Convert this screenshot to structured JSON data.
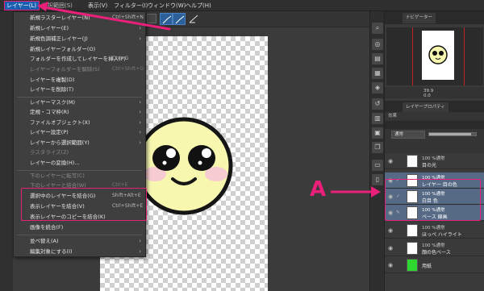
{
  "menubar": {
    "items": [
      "レイヤー(L)",
      "選択範囲(S)",
      "表示(V)",
      "フィルター(I)",
      "ウィンドウ(W)",
      "ヘルプ(H)"
    ]
  },
  "layer_menu": {
    "items": [
      {
        "label": "新規ラスターレイヤー(N)",
        "shortcut": "Ctrl+Shift+N",
        "disabled": false,
        "submenu": false
      },
      {
        "label": "新規レイヤー(E)",
        "shortcut": "",
        "disabled": false,
        "submenu": true
      },
      {
        "label": "新規色調補正レイヤー(J)",
        "shortcut": "",
        "disabled": false,
        "submenu": true
      },
      {
        "label": "新規レイヤーフォルダー(O)",
        "shortcut": "",
        "disabled": false,
        "submenu": false
      },
      {
        "label": "フォルダーを作成してレイヤーを挿入(F)",
        "shortcut": "Ctrl+G",
        "disabled": false,
        "submenu": false
      },
      {
        "label": "レイヤーフォルダーを解除(S)",
        "shortcut": "Ctrl+Shift+G",
        "disabled": true,
        "submenu": false
      },
      {
        "label": "レイヤーを複製(D)",
        "shortcut": "",
        "disabled": false,
        "submenu": false
      },
      {
        "label": "レイヤーを削除(T)",
        "shortcut": "",
        "disabled": false,
        "submenu": false
      },
      {
        "label": "レイヤーマスク(M)",
        "shortcut": "",
        "disabled": false,
        "submenu": true
      },
      {
        "label": "定規・コマ枠(R)",
        "shortcut": "",
        "disabled": false,
        "submenu": true
      },
      {
        "label": "ファイルオブジェクト(X)",
        "shortcut": "",
        "disabled": false,
        "submenu": true
      },
      {
        "label": "レイヤー設定(P)",
        "shortcut": "",
        "disabled": false,
        "submenu": true
      },
      {
        "label": "レイヤーから選択範囲(Y)",
        "shortcut": "",
        "disabled": false,
        "submenu": true
      },
      {
        "label": "ラスタライズ(Z)",
        "shortcut": "",
        "disabled": true,
        "submenu": false
      },
      {
        "label": "レイヤーの変換(H)...",
        "shortcut": "",
        "disabled": false,
        "submenu": false
      },
      {
        "label": "下のレイヤーに転写(C)",
        "shortcut": "",
        "disabled": true,
        "submenu": false
      },
      {
        "label": "下のレイヤーと結合(W)",
        "shortcut": "Ctrl+E",
        "disabled": true,
        "submenu": false
      },
      {
        "label": "選択中のレイヤーを結合(G)",
        "shortcut": "Shift+Alt+E",
        "disabled": false,
        "submenu": false
      },
      {
        "label": "表示レイヤーを結合(V)",
        "shortcut": "Ctrl+Shift+E",
        "disabled": false,
        "submenu": false
      },
      {
        "label": "表示レイヤーのコピーを結合(K)",
        "shortcut": "",
        "disabled": false,
        "submenu": false
      },
      {
        "label": "画像を統合(F)",
        "shortcut": "",
        "disabled": false,
        "submenu": false
      },
      {
        "label": "並べ替え(A)",
        "shortcut": "",
        "disabled": false,
        "submenu": true
      },
      {
        "label": "編集対象にする(I)",
        "shortcut": "",
        "disabled": false,
        "submenu": true
      }
    ]
  },
  "annotation": {
    "label": "A"
  },
  "navigator": {
    "tab_label": "ナビゲーター",
    "zoom_value": "39.9",
    "angle_value": "0.0"
  },
  "properties": {
    "tab_label": "レイヤープロパティ",
    "effect_label": "効果"
  },
  "layer_panel": {
    "blend_mode": "通常",
    "opacity_pct": 90,
    "layers": [
      {
        "mode": "100 %通常",
        "name": "目の光",
        "selected": false,
        "thumb": "white"
      },
      {
        "mode": "100 %通常",
        "name": "レイヤー 目の色",
        "selected": true,
        "thumb": "white"
      },
      {
        "mode": "100 %通常",
        "name": "白目 色",
        "selected": true,
        "thumb": "white"
      },
      {
        "mode": "100 %通常",
        "name": "ベース 線画",
        "selected": true,
        "thumb": "white"
      },
      {
        "mode": "100 %通常",
        "name": "ほっぺ ハイライト",
        "selected": false,
        "thumb": "white"
      },
      {
        "mode": "100 %通常",
        "name": "顔の色ベース",
        "selected": false,
        "thumb": "white"
      },
      {
        "mode": "",
        "name": "用紙",
        "selected": false,
        "thumb": "green"
      }
    ]
  },
  "colors": {
    "accent_highlight": "#e8207a",
    "menu_selected": "#1a5fb0",
    "layer_selected": "#566a86",
    "face_fill": "#f7f7b0"
  }
}
